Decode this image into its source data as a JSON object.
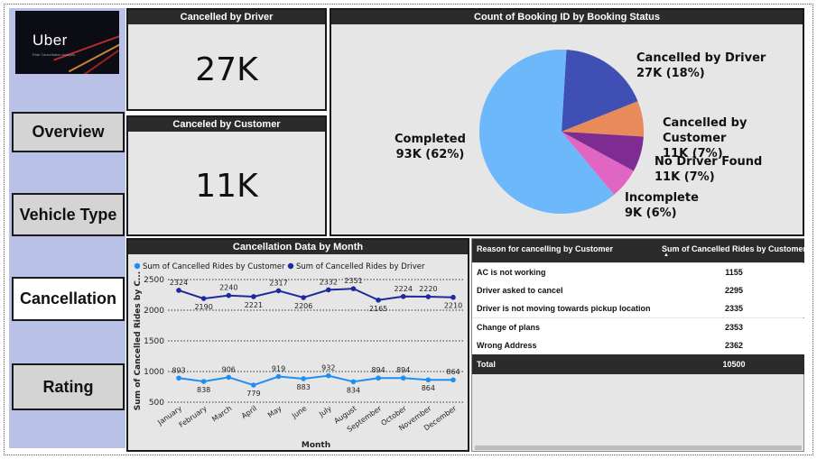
{
  "sidebar": {
    "logo_text": "Uber",
    "logo_sub": "Ride Cancellation Analysis",
    "nav": [
      "Overview",
      "Vehicle Type",
      "Cancellation",
      "Rating"
    ],
    "active": "Cancellation"
  },
  "kpi_driver": {
    "title": "Cancelled by Driver",
    "value": "27K"
  },
  "kpi_customer": {
    "title": "Canceled by Customer",
    "value": "11K"
  },
  "pie": {
    "title": "Count of Booking ID by Booking Status",
    "slices": [
      {
        "label": "Completed",
        "value_label": "93K (62%)",
        "value": 62,
        "color": "#6cb8fb"
      },
      {
        "label": "Cancelled by Driver",
        "value_label": "27K (18%)",
        "value": 18,
        "color": "#3f4fb3"
      },
      {
        "label": "Cancelled by Customer",
        "value_label": "11K (7%)",
        "value": 7,
        "color": "#e98a5b"
      },
      {
        "label": "No Driver Found",
        "value_label": "11K (7%)",
        "value": 7,
        "color": "#7e2c91"
      },
      {
        "label": "Incomplete",
        "value_label": "9K (6%)",
        "value": 6,
        "color": "#e165c2"
      }
    ]
  },
  "chart_data": {
    "type": "line",
    "title": "Cancellation Data by Month",
    "xlabel": "Month",
    "ylabel": "Sum of Cancelled Rides by C...",
    "ylim": [
      500,
      2500
    ],
    "yticks": [
      500,
      1000,
      1500,
      2000,
      2500
    ],
    "grid": true,
    "legend": "top-left",
    "categories": [
      "January",
      "February",
      "March",
      "April",
      "May",
      "June",
      "July",
      "August",
      "September",
      "October",
      "November",
      "December"
    ],
    "series": [
      {
        "name": "Sum of Cancelled Rides by Customer",
        "color": "#1f8ef1",
        "values": [
          893,
          838,
          906,
          779,
          919,
          883,
          932,
          834,
          894,
          894,
          864,
          864
        ]
      },
      {
        "name": "Sum of Cancelled Rides by Driver",
        "color": "#1c2a9e",
        "values": [
          2324,
          2190,
          2240,
          2221,
          2317,
          2206,
          2332,
          2351,
          2165,
          2224,
          2220,
          2210
        ]
      }
    ]
  },
  "table": {
    "headers": [
      "Reason for cancelling by Customer",
      "Sum of Cancelled Rides by Customer"
    ],
    "rows": [
      [
        "AC is not working",
        "1155"
      ],
      [
        "Driver asked to cancel",
        "2295"
      ],
      [
        "Driver is not moving towards pickup location",
        "2335"
      ],
      [
        "Change of plans",
        "2353"
      ],
      [
        "Wrong Address",
        "2362"
      ]
    ],
    "total": [
      "Total",
      "10500"
    ]
  }
}
